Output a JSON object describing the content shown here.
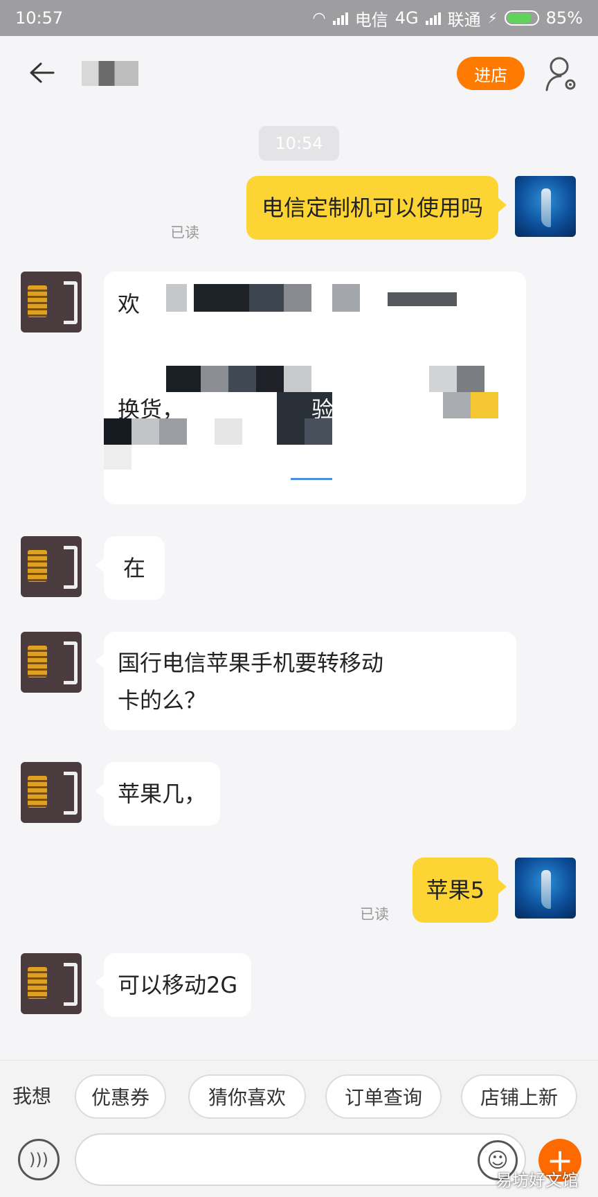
{
  "status_bar": {
    "time": "10:57",
    "carrier1": "电信",
    "network": "4G",
    "carrier2": "联通",
    "battery": "85%"
  },
  "header": {
    "enter_store_label": "进店",
    "back_icon": "arrow-left-icon",
    "user_icon": "user-settings-icon"
  },
  "chat": {
    "timestamp": "10:54",
    "messages": [
      {
        "sender": "me",
        "text": "电信定制机可以使用吗",
        "status": "已读"
      },
      {
        "sender": "shop",
        "text": "在"
      },
      {
        "sender": "shop",
        "text": "国行电信苹果手机要转移动\n卡的么？"
      },
      {
        "sender": "shop",
        "text": "苹果几，"
      },
      {
        "sender": "me",
        "text": "苹果5",
        "status": "已读"
      },
      {
        "sender": "shop",
        "text": "可以移动2G"
      }
    ],
    "obscured_message_fragments": [
      "欢",
      "换货，",
      "验退货"
    ]
  },
  "quick_replies": {
    "label": "我想",
    "items": [
      "优惠券",
      "猜你喜欢",
      "订单查询",
      "店铺上新"
    ]
  },
  "input_bar": {
    "voice_icon": "voice-icon",
    "emoji_icon": "emoji-icon",
    "plus_icon": "plus-icon"
  },
  "watermark": "易坊好文馆",
  "colors": {
    "accent": "#ff7a00",
    "my_bubble": "#fcd535",
    "shop_bubble": "#ffffff"
  }
}
